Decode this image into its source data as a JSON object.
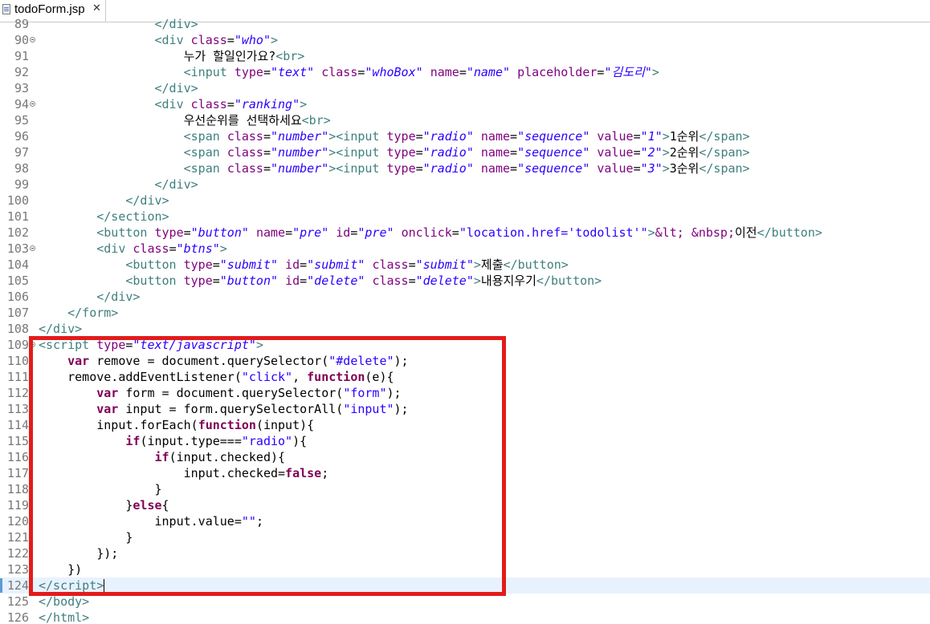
{
  "tab": {
    "filename": "todoForm.jsp",
    "close_glyph": "✕"
  },
  "editor": {
    "current_line": "124",
    "lines": [
      {
        "num": "89",
        "html": "                <span class='t'>&lt;/div&gt;</span>"
      },
      {
        "num": "90",
        "fold": true,
        "html": "                <span class='t'>&lt;div</span> <span class='a'>class</span>=<span class='s'>\"who\"</span><span class='t'>&gt;</span>"
      },
      {
        "num": "91",
        "html": "                    누가 할일인가요?<span class='t'>&lt;br&gt;</span>"
      },
      {
        "num": "92",
        "html": "                    <span class='t'>&lt;input</span> <span class='a'>type</span>=<span class='s'>\"text\"</span> <span class='a'>class</span>=<span class='s'>\"whoBox\"</span> <span class='a'>name</span>=<span class='s'>\"name\"</span> <span class='a'>placeholder</span>=<span class='s'>\"김도리\"</span><span class='t'>&gt;</span>"
      },
      {
        "num": "93",
        "html": "                <span class='t'>&lt;/div&gt;</span>"
      },
      {
        "num": "94",
        "fold": true,
        "html": "                <span class='t'>&lt;div</span> <span class='a'>class</span>=<span class='s'>\"ranking\"</span><span class='t'>&gt;</span>"
      },
      {
        "num": "95",
        "html": "                    우선순위를 선택하세요<span class='t'>&lt;br&gt;</span>"
      },
      {
        "num": "96",
        "html": "                    <span class='t'>&lt;span</span> <span class='a'>class</span>=<span class='s'>\"number\"</span><span class='t'>&gt;&lt;input</span> <span class='a'>type</span>=<span class='s'>\"radio\"</span> <span class='a'>name</span>=<span class='s'>\"sequence\"</span> <span class='a'>value</span>=<span class='s'>\"1\"</span><span class='t'>&gt;</span>1순위<span class='t'>&lt;/span&gt;</span>"
      },
      {
        "num": "97",
        "html": "                    <span class='t'>&lt;span</span> <span class='a'>class</span>=<span class='s'>\"number\"</span><span class='t'>&gt;&lt;input</span> <span class='a'>type</span>=<span class='s'>\"radio\"</span> <span class='a'>name</span>=<span class='s'>\"sequence\"</span> <span class='a'>value</span>=<span class='s'>\"2\"</span><span class='t'>&gt;</span>2순위<span class='t'>&lt;/span&gt;</span>"
      },
      {
        "num": "98",
        "html": "                    <span class='t'>&lt;span</span> <span class='a'>class</span>=<span class='s'>\"number\"</span><span class='t'>&gt;&lt;input</span> <span class='a'>type</span>=<span class='s'>\"radio\"</span> <span class='a'>name</span>=<span class='s'>\"sequence\"</span> <span class='a'>value</span>=<span class='s'>\"3\"</span><span class='t'>&gt;</span>3순위<span class='t'>&lt;/span&gt;</span>"
      },
      {
        "num": "99",
        "html": "                <span class='t'>&lt;/div&gt;</span>"
      },
      {
        "num": "100",
        "html": "            <span class='t'>&lt;/div&gt;</span>"
      },
      {
        "num": "101",
        "html": "        <span class='t'>&lt;/section&gt;</span>"
      },
      {
        "num": "102",
        "html": "        <span class='t'>&lt;button</span> <span class='a'>type</span>=<span class='s'>\"button\"</span> <span class='a'>name</span>=<span class='s'>\"pre\"</span> <span class='a'>id</span>=<span class='s'>\"pre\"</span> <span class='a'>onclick</span>=<span class='js'>\"location.href='todolist'\"</span><span class='t'>&gt;</span><span class='a'>&amp;lt;</span> <span class='a'>&amp;nbsp;</span>이전<span class='t'>&lt;/button&gt;</span>"
      },
      {
        "num": "103",
        "fold": true,
        "html": "        <span class='t'>&lt;div</span> <span class='a'>class</span>=<span class='s'>\"btns\"</span><span class='t'>&gt;</span>"
      },
      {
        "num": "104",
        "html": "            <span class='t'>&lt;button</span> <span class='a'>type</span>=<span class='s'>\"submit\"</span> <span class='a'>id</span>=<span class='s'>\"submit\"</span> <span class='a'>class</span>=<span class='s'>\"submit\"</span><span class='t'>&gt;</span>제출<span class='t'>&lt;/button&gt;</span>"
      },
      {
        "num": "105",
        "html": "            <span class='t'>&lt;button</span> <span class='a'>type</span>=<span class='s'>\"button\"</span> <span class='a'>id</span>=<span class='s'>\"delete\"</span> <span class='a'>class</span>=<span class='s'>\"delete\"</span><span class='t'>&gt;</span>내용지우기<span class='t'>&lt;/button&gt;</span>"
      },
      {
        "num": "106",
        "html": "        <span class='t'>&lt;/div&gt;</span>"
      },
      {
        "num": "107",
        "html": "    <span class='t'>&lt;/form&gt;</span>"
      },
      {
        "num": "108",
        "html": "<span class='t'>&lt;/div&gt;</span>"
      },
      {
        "num": "109",
        "fold": true,
        "html": "<span class='t'>&lt;script</span> <span class='a'>type</span>=<span class='s'>\"text/javascript\"</span><span class='t'>&gt;</span>"
      },
      {
        "num": "110",
        "html": "    <span class='kw'>var</span> remove = document.querySelector(<span class='js'>\"#delete\"</span>);"
      },
      {
        "num": "111",
        "html": "    remove.addEventListener(<span class='js'>\"click\"</span>, <span class='kw'>function</span>(e){"
      },
      {
        "num": "112",
        "html": "        <span class='kw'>var</span> form = document.querySelector(<span class='js'>\"form\"</span>);"
      },
      {
        "num": "113",
        "html": "        <span class='kw'>var</span> input = form.querySelectorAll(<span class='js'>\"input\"</span>);"
      },
      {
        "num": "114",
        "html": "        input.forEach(<span class='kw'>function</span>(input){"
      },
      {
        "num": "115",
        "html": "            <span class='kw'>if</span>(input.type===<span class='js'>\"radio\"</span>){"
      },
      {
        "num": "116",
        "html": "                <span class='kw'>if</span>(input.checked){"
      },
      {
        "num": "117",
        "html": "                    input.checked=<span class='kw'>false</span>;"
      },
      {
        "num": "118",
        "html": "                }"
      },
      {
        "num": "119",
        "html": "            }<span class='kw'>else</span>{"
      },
      {
        "num": "120",
        "html": "                input.value=<span class='js'>\"\"</span>;"
      },
      {
        "num": "121",
        "html": "            }"
      },
      {
        "num": "122",
        "html": "        });"
      },
      {
        "num": "123",
        "html": "    })"
      },
      {
        "num": "124",
        "current": true,
        "caret": true,
        "html": "<span class='t'>&lt;/script&gt;</span>"
      },
      {
        "num": "125",
        "html": "<span class='t'>&lt;/body&gt;</span>"
      },
      {
        "num": "126",
        "html": "<span class='t'>&lt;/html&gt;</span>"
      }
    ]
  },
  "annotation": {
    "box_color": "#e31b1b"
  }
}
